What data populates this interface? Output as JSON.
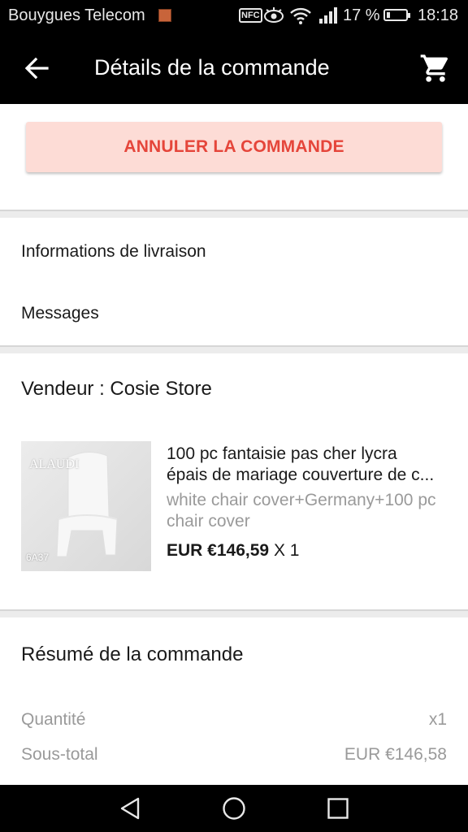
{
  "status_bar": {
    "carrier": "Bouygues Telecom",
    "nfc": "NFC",
    "battery_text": "17 %",
    "battery_level": 0.17,
    "time": "18:18"
  },
  "app_bar": {
    "title": "Détails de la commande",
    "back_icon": "arrow-left-icon",
    "cart_icon": "shopping-cart-icon"
  },
  "actions": {
    "cancel_label": "ANNULER LA COMMANDE"
  },
  "info": {
    "delivery_label": "Informations de livraison",
    "messages_label": "Messages"
  },
  "seller": {
    "label": "Vendeur : Cosie Store"
  },
  "product": {
    "title_line1": "100 pc fantaisie pas cher lycra",
    "title_line2": "épais de mariage couverture de c...",
    "variant": "white chair cover+Germany+100 pc chair cover",
    "price": "EUR €146,59",
    "quantity": "X 1",
    "image_brand": "ALAUDI",
    "image_code": "6A37"
  },
  "summary": {
    "heading": "Résumé de la commande",
    "rows": [
      {
        "label": "Quantité",
        "value": "x1"
      },
      {
        "label": "Sous-total",
        "value": "EUR €146,58"
      }
    ]
  },
  "nav_bar": {
    "back_icon": "triangle-back-icon",
    "home_icon": "circle-home-icon",
    "recents_icon": "square-recents-icon"
  },
  "colors": {
    "cancel_bg": "#fddcd6",
    "cancel_text": "#e5453a",
    "app_bar_bg": "#000000"
  }
}
